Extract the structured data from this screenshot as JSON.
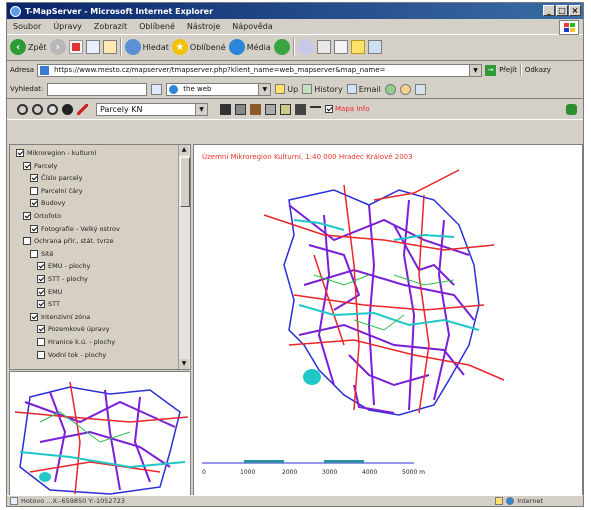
{
  "window": {
    "title": "T-MapServer - Microsoft Internet Explorer",
    "controls": [
      "_",
      "□",
      "×"
    ]
  },
  "menu": [
    "Soubor",
    "Úpravy",
    "Zobrazit",
    "Oblíbené",
    "Nástroje",
    "Nápověda"
  ],
  "toolbar": {
    "back": "Zpět",
    "search": "Hledat",
    "favorites": "Oblíbené",
    "media": "Média"
  },
  "address": {
    "label": "Adresa",
    "url": "https://www.mesto.cz/mapserver/tmapserver.php?klient_name=web_mapserver&map_name=",
    "go": "Přejít",
    "links": "Odkazy"
  },
  "google_bar": {
    "label": "Vyhledat:",
    "search_web": "the web",
    "up": "Up",
    "history": "History",
    "email": "Email"
  },
  "map_toolbar": {
    "layer_select": "Parcely KN",
    "show_label": "Mapa Info"
  },
  "layers": [
    {
      "label": "Mikroregion - kulturní",
      "checked": true,
      "indent": 0
    },
    {
      "label": "Parcely",
      "checked": true,
      "indent": 1
    },
    {
      "label": "Číslo parcely",
      "checked": true,
      "indent": 2
    },
    {
      "label": "Parcelní čáry",
      "checked": false,
      "indent": 2
    },
    {
      "label": "Budovy",
      "checked": true,
      "indent": 2
    },
    {
      "label": "Ortofoto",
      "checked": true,
      "indent": 1
    },
    {
      "label": "Fotografie - Velký ostrov",
      "checked": true,
      "indent": 2
    },
    {
      "label": "Ochrana přír., stát. tvrze",
      "checked": false,
      "indent": 1
    },
    {
      "label": "Sítě",
      "checked": false,
      "indent": 2
    },
    {
      "label": "EMU - plochy",
      "checked": true,
      "indent": 3
    },
    {
      "label": "STT - plochy",
      "checked": true,
      "indent": 3
    },
    {
      "label": "EMU",
      "checked": true,
      "indent": 3
    },
    {
      "label": "STT",
      "checked": true,
      "indent": 3
    },
    {
      "label": "Intenzivní zóna",
      "checked": true,
      "indent": 2
    },
    {
      "label": "Pozemkové úpravy",
      "checked": true,
      "indent": 3
    },
    {
      "label": "Hranice k.ú. - plochy",
      "checked": false,
      "indent": 3
    },
    {
      "label": "Vodní tok - plochy",
      "checked": false,
      "indent": 3
    }
  ],
  "map": {
    "title": "Územní Mikroregion Kulturní, 1:40 000 Hradec Králové 2003",
    "scale_labels": [
      "0",
      "1000",
      "2000",
      "3000",
      "4000",
      "5000 m"
    ]
  },
  "status": {
    "text": "Hotovo  ...X:-659850 Y:-1052723",
    "zone": "Internet"
  },
  "colors": {
    "roads_red": "#e8262a",
    "paths_purple": "#7a1fd6",
    "water_cyan": "#1ec8c8",
    "boundary_blue": "#2a2fd6",
    "green": "#2fbf4f"
  }
}
